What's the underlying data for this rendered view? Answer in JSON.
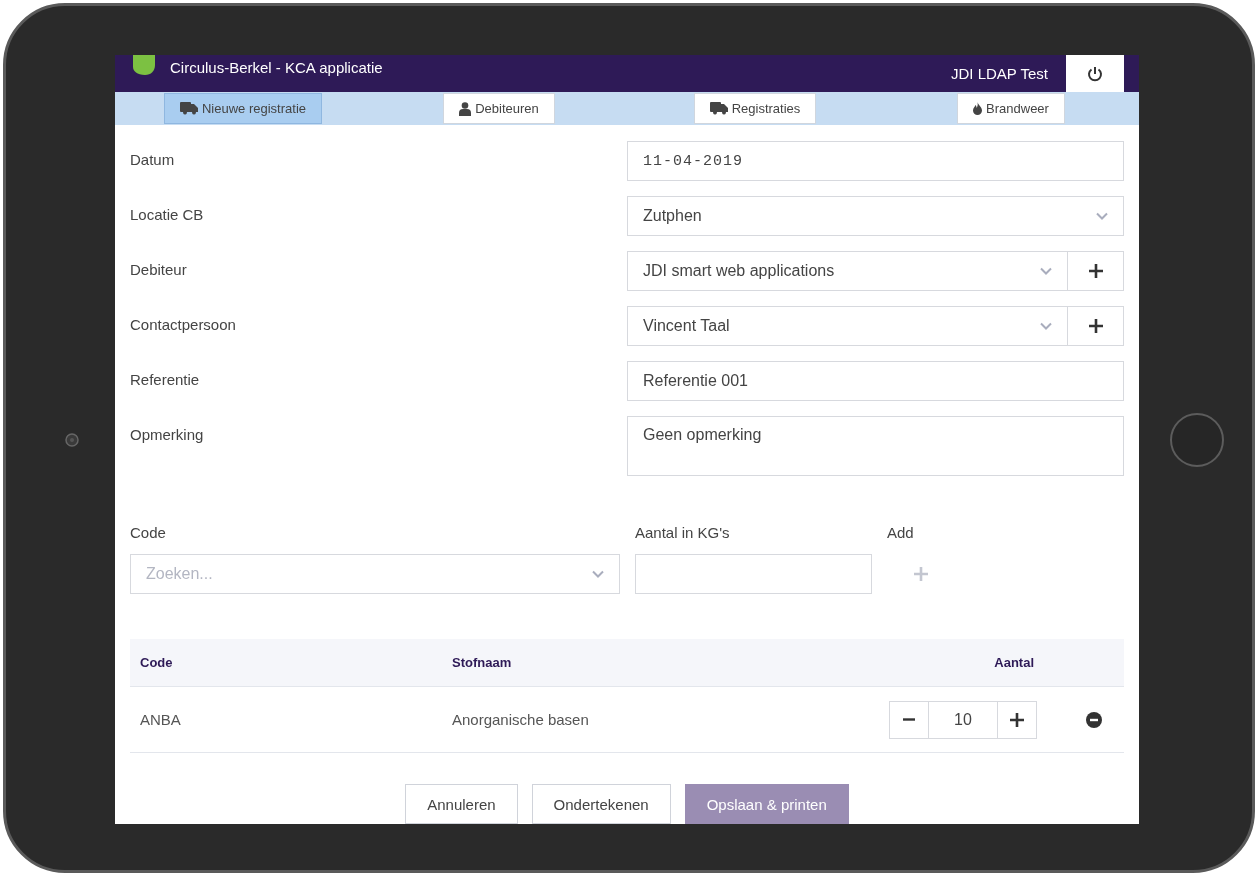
{
  "app": {
    "title": "Circulus-Berkel - KCA applicatie",
    "user": "JDI LDAP Test"
  },
  "nav": [
    {
      "label": "Nieuwe registratie",
      "kind": "truck",
      "selected": true
    },
    {
      "label": "Debiteuren",
      "kind": "person",
      "selected": false
    },
    {
      "label": "Registraties",
      "kind": "truck",
      "selected": false
    },
    {
      "label": "Brandweer",
      "kind": "flame",
      "selected": false
    }
  ],
  "form": [
    {
      "label": "Datum",
      "kind": "date",
      "value": "11-04-2019"
    },
    {
      "label": "Locatie CB",
      "kind": "select",
      "value": "Zutphen"
    },
    {
      "label": "Debiteur",
      "kind": "select-add",
      "value": "JDI smart web applications"
    },
    {
      "label": "Contactpersoon",
      "kind": "select-add",
      "value": "Vincent Taal"
    },
    {
      "label": "Referentie",
      "kind": "text",
      "value": "Referentie 001"
    },
    {
      "label": "Opmerking",
      "kind": "textarea",
      "value": "Geen opmerking"
    }
  ],
  "add_line": {
    "code_label": "Code",
    "code_placeholder": "Zoeken...",
    "amount_label": "Aantal in KG's",
    "add_label": "Add"
  },
  "table": {
    "columns": [
      "Code",
      "Stofnaam",
      "Aantal"
    ],
    "rows": [
      {
        "code": "ANBA",
        "name": "Anorganische basen",
        "amount": "10"
      }
    ]
  },
  "buttons": [
    {
      "label": "Annuleren",
      "kind": "default"
    },
    {
      "label": "Ondertekenen",
      "kind": "default"
    },
    {
      "label": "Opslaan & printen",
      "kind": "primary"
    }
  ]
}
